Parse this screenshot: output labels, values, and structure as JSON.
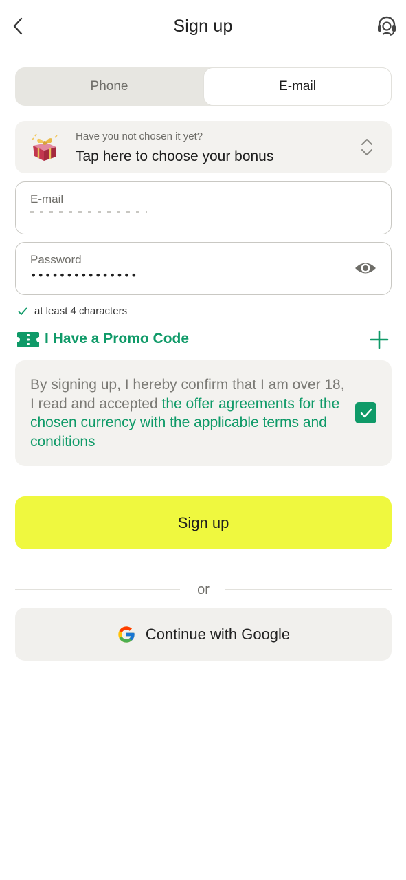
{
  "header": {
    "title": "Sign up",
    "back_icon": "chevron-left-icon",
    "support_icon": "headset-support-icon"
  },
  "tabs": [
    {
      "label": "Phone",
      "selected": false
    },
    {
      "label": "E-mail",
      "selected": true
    }
  ],
  "bonus": {
    "subtitle": "Have you not chosen it yet?",
    "label": "Tap here to choose your bonus",
    "icon": "gift-box-icon"
  },
  "email_field": {
    "label": "E-mail",
    "value": ""
  },
  "password_field": {
    "label": "Password",
    "masked_value": "•••••••••••••••"
  },
  "password_hint": "at least 4 characters",
  "promo": {
    "label": "I Have a Promo Code",
    "icon": "ticket-icon",
    "action_icon": "plus-icon"
  },
  "terms": {
    "text_plain": "By signing up, I hereby confirm that I am over 18, I read and accepted ",
    "text_link": "the offer agreements for the chosen currency with the applicable terms and conditions",
    "checked": true
  },
  "signup_button": "Sign up",
  "divider_text": "or",
  "google_button": "Continue with Google",
  "colors": {
    "accent_green": "#0f9a68",
    "signup_yellow": "#eff83f",
    "panel_gray": "#f3f2ef"
  }
}
